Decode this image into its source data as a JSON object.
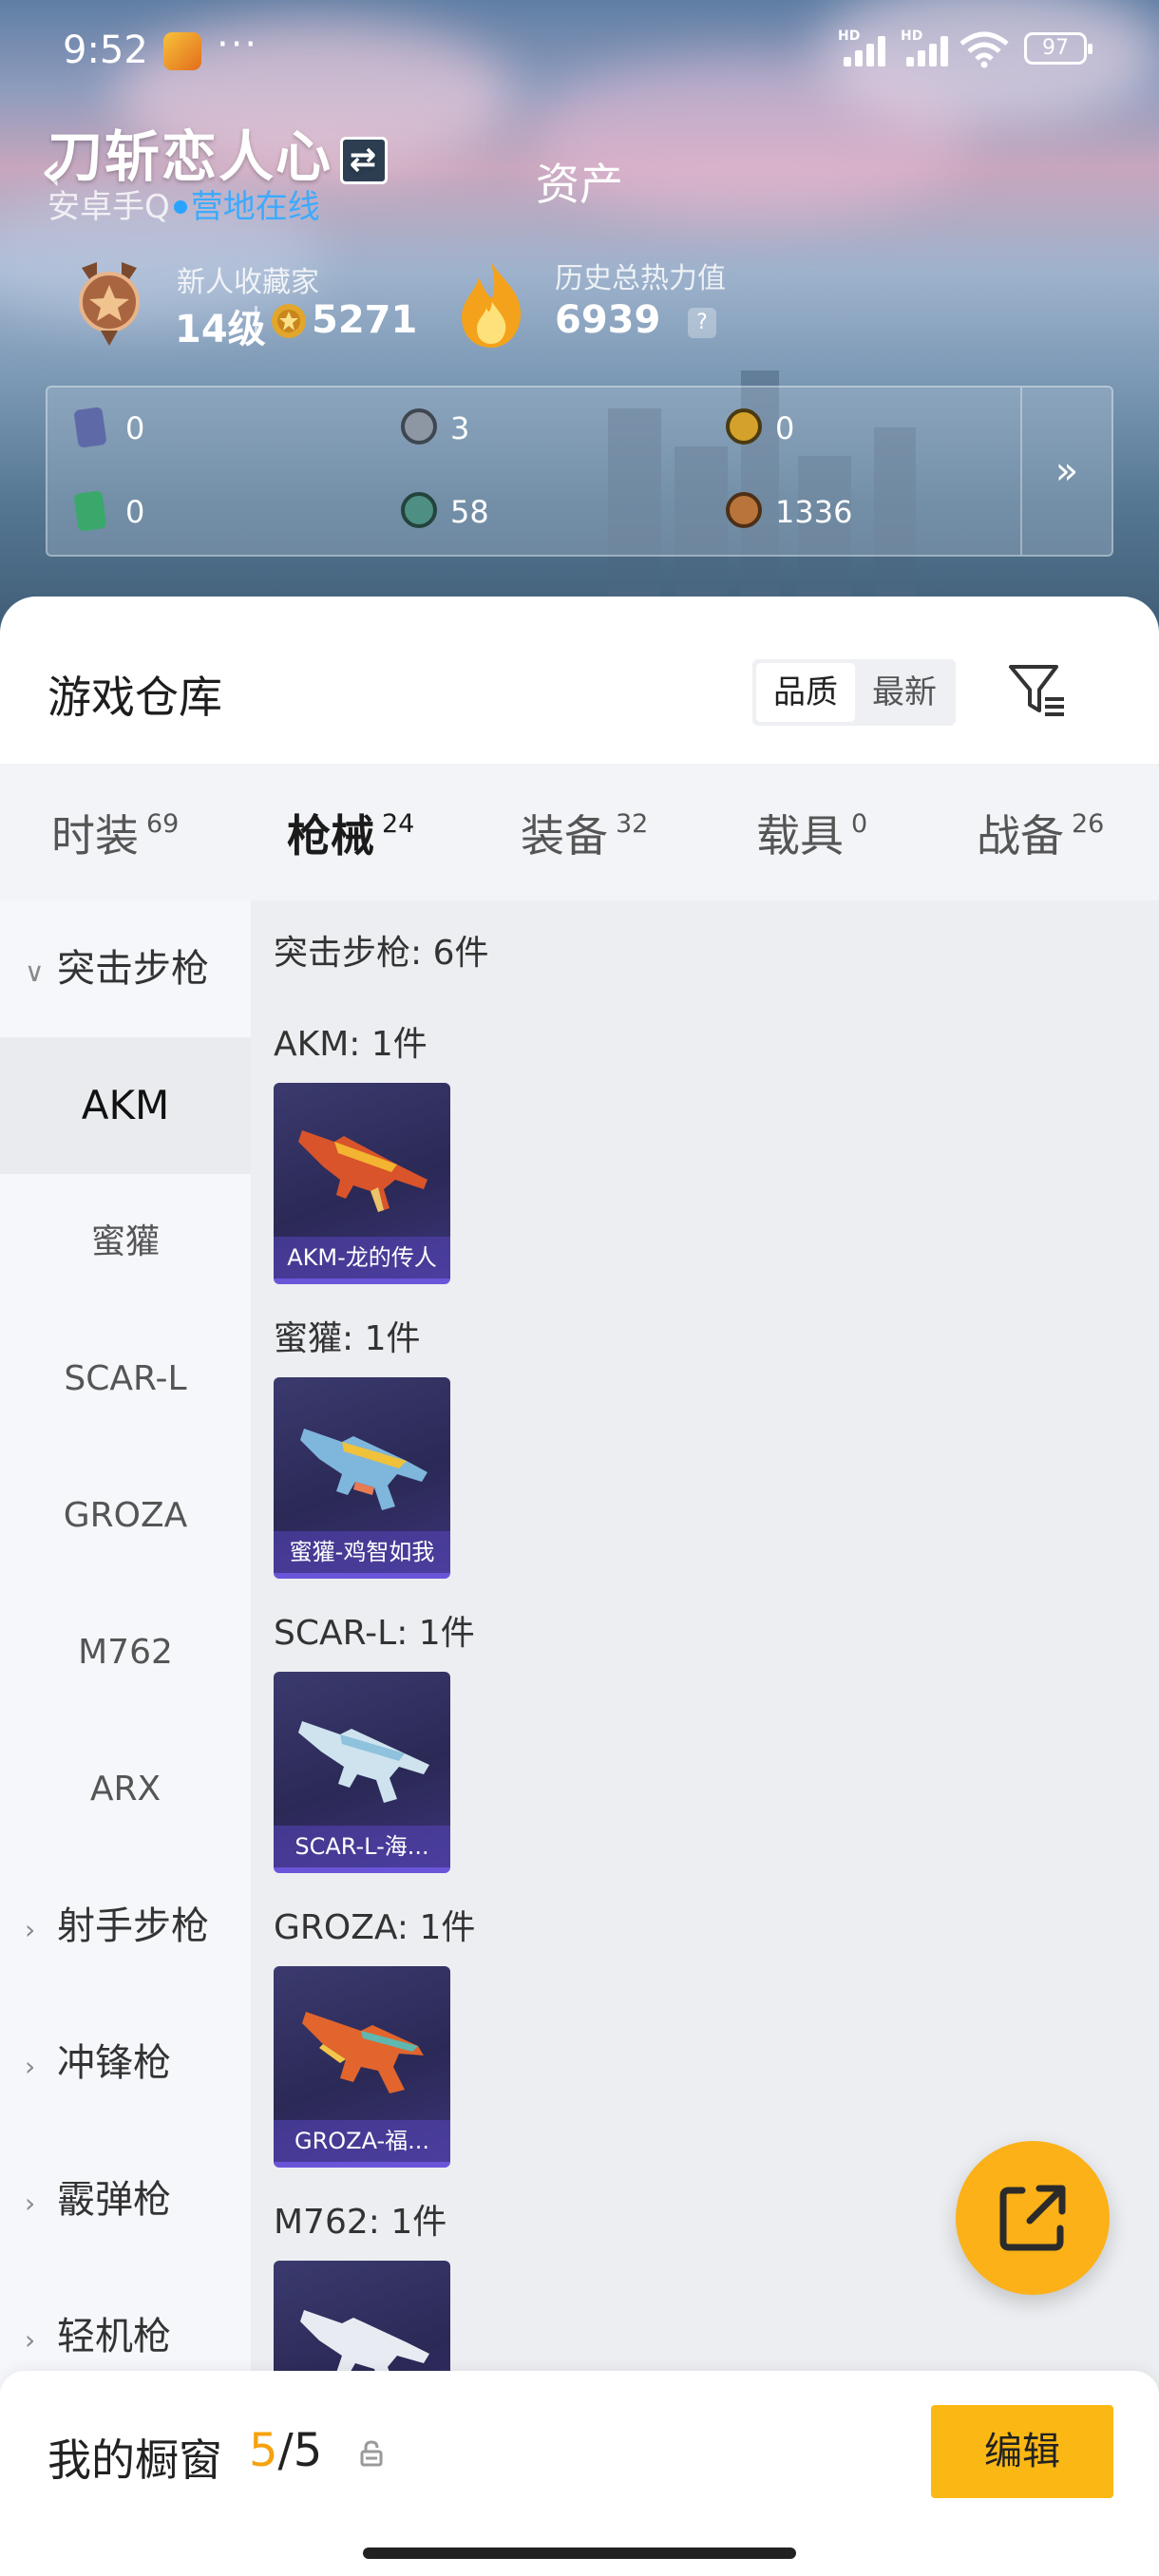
{
  "status_bar": {
    "time": "9:52",
    "more": "···",
    "hd1": "HD",
    "hd2": "HD",
    "battery": "97"
  },
  "header": {
    "username": "刀斩恋人心",
    "swap_icon": "⇄",
    "page_title": "资产",
    "platform": "安卓手Q",
    "online_status": "营地在线",
    "level_title": "新人收藏家",
    "level": "14级",
    "points": "5271",
    "heat_label": "历史总热力值",
    "heat_value": "6939",
    "help": "?"
  },
  "assets": {
    "items": [
      {
        "icon": "card-icon",
        "value": "0",
        "color": "#6b78b6"
      },
      {
        "icon": "silver-coin-icon",
        "value": "3",
        "color": "#8d96a3"
      },
      {
        "icon": "gold-token-icon",
        "value": "0",
        "color": "#d4a12a"
      },
      {
        "icon": "green-card-icon",
        "value": "0",
        "color": "#3aa86a"
      },
      {
        "icon": "teal-coin-icon",
        "value": "58",
        "color": "#4d8f82"
      },
      {
        "icon": "bronze-coin-icon",
        "value": "1336",
        "color": "#b8743a"
      }
    ],
    "more": "»"
  },
  "warehouse": {
    "title": "游戏仓库",
    "sort": {
      "quality": "品质",
      "newest": "最新",
      "selected": "品质"
    }
  },
  "tabs": [
    {
      "label": "时装",
      "count": "69"
    },
    {
      "label": "枪械",
      "count": "24"
    },
    {
      "label": "装备",
      "count": "32"
    },
    {
      "label": "载具",
      "count": "0"
    },
    {
      "label": "战备",
      "count": "26"
    }
  ],
  "sidebar": {
    "expanded_category": "突击步枪",
    "items": [
      "AKM",
      "蜜獾",
      "SCAR-L",
      "GROZA",
      "M762",
      "ARX"
    ],
    "collapsed_categories": [
      "射手步枪",
      "冲锋枪",
      "霰弹枪",
      "轻机枪"
    ]
  },
  "content": {
    "section_title": "突击步枪: 6件",
    "groups": [
      {
        "title": "AKM: 1件",
        "item": "AKM-龙的传人"
      },
      {
        "title": "蜜獾: 1件",
        "item": "蜜獾-鸡智如我"
      },
      {
        "title": "SCAR-L: 1件",
        "item": "SCAR-L-海..."
      },
      {
        "title": "GROZA: 1件",
        "item": "GROZA-福..."
      },
      {
        "title": "M762: 1件",
        "item": ""
      }
    ]
  },
  "bottom": {
    "label": "我的橱窗",
    "count_current": "5",
    "count_sep": "/",
    "count_total": "5",
    "edit": "编辑"
  },
  "colors": {
    "accent": "#fbb814",
    "link": "#28a4ff",
    "tab_underline": "#f5a20c",
    "card_bg": "#2b2956"
  }
}
